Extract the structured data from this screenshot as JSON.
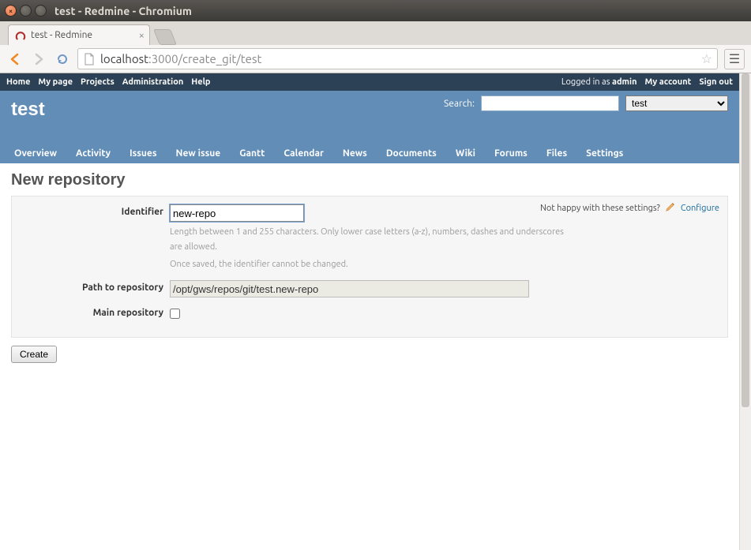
{
  "os_window": {
    "title": "test - Redmine - Chromium"
  },
  "browser": {
    "tab_title": "test - Redmine",
    "url_host": "localhost",
    "url_port_path": ":3000/create_git/test"
  },
  "top_menu": {
    "left": [
      "Home",
      "My page",
      "Projects",
      "Administration",
      "Help"
    ],
    "logged_in_prefix": "Logged in as ",
    "logged_in_user": "admin",
    "right_links": [
      "My account",
      "Sign out"
    ]
  },
  "header": {
    "project_title": "test",
    "search_label": "Search:",
    "search_value": "",
    "project_select_value": "test"
  },
  "main_menu": [
    "Overview",
    "Activity",
    "Issues",
    "New issue",
    "Gantt",
    "Calendar",
    "News",
    "Documents",
    "Wiki",
    "Forums",
    "Files",
    "Settings"
  ],
  "page": {
    "heading": "New repository",
    "contextual_text": "Not happy with these settings?",
    "configure_link": "Configure",
    "identifier_label": "Identifier",
    "identifier_value": "new-repo",
    "identifier_hint1": "Length between 1 and 255 characters. Only lower case letters (a-z), numbers, dashes and underscores are allowed.",
    "identifier_hint2": "Once saved, the identifier cannot be changed.",
    "path_label": "Path to repository",
    "path_value": "/opt/gws/repos/git/test.new-repo",
    "main_repo_label": "Main repository",
    "main_repo_checked": false,
    "submit_label": "Create"
  }
}
